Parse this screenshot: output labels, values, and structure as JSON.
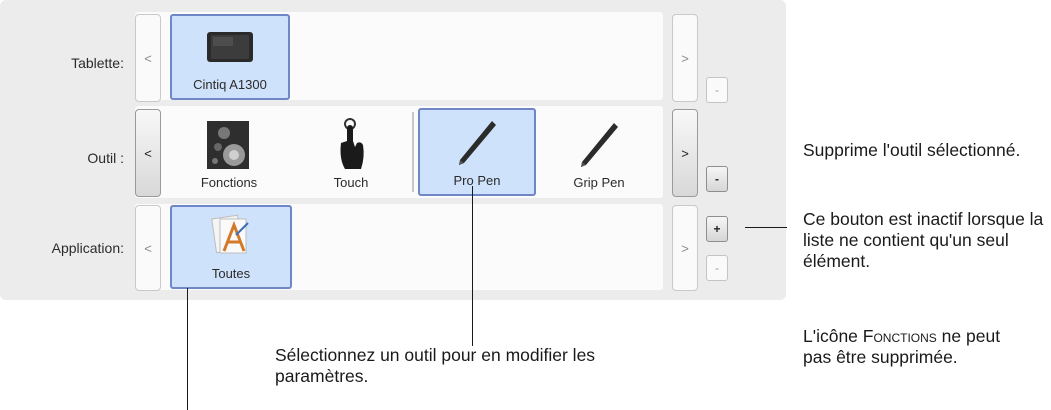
{
  "rows": {
    "tablet": {
      "label": "Tablette:",
      "items": [
        {
          "label": "Cintiq A1300",
          "icon": "tablet-icon",
          "selected": true
        }
      ]
    },
    "tool": {
      "label": "Outil :",
      "items": [
        {
          "label": "Fonctions",
          "icon": "functions-icon",
          "selected": false
        },
        {
          "label": "Touch",
          "icon": "touch-hand-icon",
          "selected": false
        },
        {
          "label": "Pro Pen",
          "icon": "pen-icon",
          "selected": true
        },
        {
          "label": "Grip Pen",
          "icon": "pen-icon",
          "selected": false
        }
      ]
    },
    "application": {
      "label": "Application:",
      "items": [
        {
          "label": "Toutes",
          "icon": "all-apps-icon",
          "selected": true
        }
      ]
    }
  },
  "buttons": {
    "prev": "<",
    "next": ">",
    "remove": "-",
    "add": "+"
  },
  "callouts": {
    "remove_tool": "Supprime l'outil sélectionné.",
    "inactive_note": "Ce bouton est inactif lorsque la liste ne contient qu'un seul élément.",
    "functions_note_prefix": "L'icône ",
    "functions_note_name": "Fonctions",
    "functions_note_suffix": " ne peut pas être supprimée.",
    "select_tool": "Sélectionnez un outil pour en modifier les paramètres."
  },
  "colors": {
    "selection_fill": "#cfe2fb",
    "selection_border": "#6f86c7",
    "panel_bg": "#ececec"
  }
}
